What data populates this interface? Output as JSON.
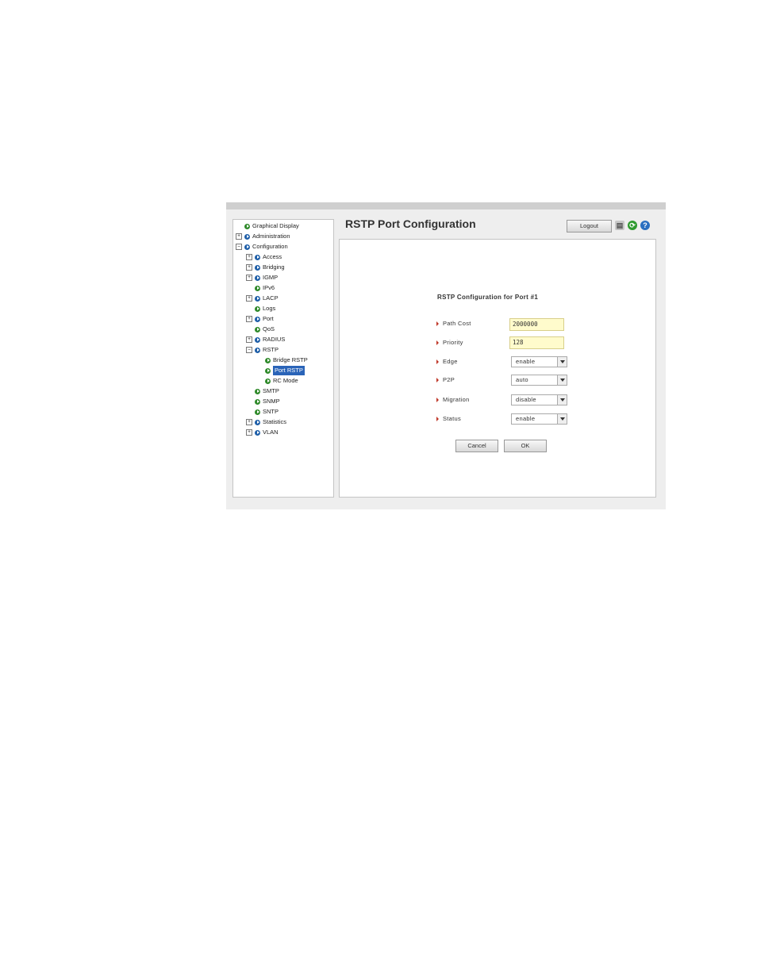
{
  "page": {
    "title": "RSTP Port Configuration"
  },
  "toolbar": {
    "logout_label": "Logout",
    "print_icon": "print-icon",
    "refresh_icon": "refresh-icon",
    "help_icon": "help-icon",
    "refresh_glyph": "⟳",
    "help_glyph": "?"
  },
  "tree": [
    {
      "label": "Graphical Display",
      "expander": "",
      "color": "green"
    },
    {
      "label": "Administration",
      "expander": "+",
      "color": "blue"
    },
    {
      "label": "Configuration",
      "expander": "−",
      "color": "blue"
    },
    {
      "label": "Access",
      "expander": "+",
      "color": "blue"
    },
    {
      "label": "Bridging",
      "expander": "+",
      "color": "blue"
    },
    {
      "label": "IGMP",
      "expander": "+",
      "color": "blue"
    },
    {
      "label": "IPv6",
      "expander": "",
      "color": "green"
    },
    {
      "label": "LACP",
      "expander": "+",
      "color": "blue"
    },
    {
      "label": "Logs",
      "expander": "",
      "color": "green"
    },
    {
      "label": "Port",
      "expander": "+",
      "color": "blue"
    },
    {
      "label": "QoS",
      "expander": "",
      "color": "green"
    },
    {
      "label": "RADIUS",
      "expander": "+",
      "color": "blue"
    },
    {
      "label": "RSTP",
      "expander": "−",
      "color": "blue"
    },
    {
      "label": "Bridge RSTP",
      "expander": "",
      "color": "green"
    },
    {
      "label": "Port RSTP",
      "expander": "",
      "color": "green",
      "selected": true
    },
    {
      "label": "RC Mode",
      "expander": "",
      "color": "green"
    },
    {
      "label": "SMTP",
      "expander": "",
      "color": "green"
    },
    {
      "label": "SNMP",
      "expander": "",
      "color": "green"
    },
    {
      "label": "SNTP",
      "expander": "",
      "color": "green"
    },
    {
      "label": "Statistics",
      "expander": "+",
      "color": "blue"
    },
    {
      "label": "VLAN",
      "expander": "+",
      "color": "blue"
    }
  ],
  "form": {
    "title": "RSTP Configuration for Port #1",
    "path_cost": {
      "label": "Path Cost",
      "value": "2000000"
    },
    "priority": {
      "label": "Priority",
      "value": "128"
    },
    "edge": {
      "label": "Edge",
      "value": "enable"
    },
    "p2p": {
      "label": "P2P",
      "value": "auto"
    },
    "migration": {
      "label": "Migration",
      "value": "disable"
    },
    "status": {
      "label": "Status",
      "value": "enable"
    },
    "cancel_label": "Cancel",
    "ok_label": "OK"
  }
}
